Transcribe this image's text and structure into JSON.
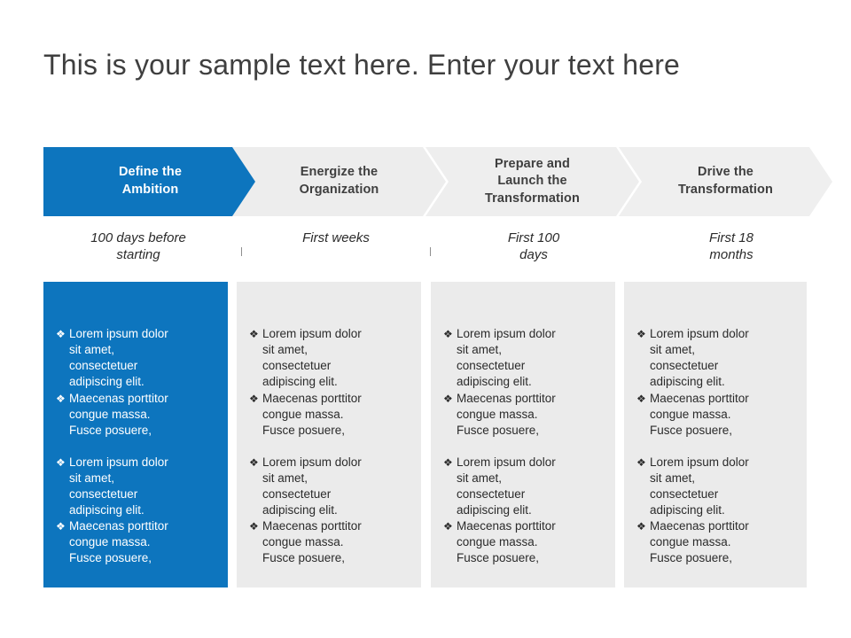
{
  "slide": {
    "title": "This is your sample text here. Enter your text here",
    "accent_color": "#0d75be",
    "idle_color": "#ebebeb",
    "text_color": "#3f3f3f"
  },
  "steps": [
    {
      "chevron_label": "Define the\nAmbition",
      "timeline_label": "100 days before\nstarting",
      "state": "active"
    },
    {
      "chevron_label": "Energize the\nOrganization",
      "timeline_label": "First weeks",
      "state": "idle"
    },
    {
      "chevron_label": "Prepare and\nLaunch the\nTransformation",
      "timeline_label": "First 100\ndays",
      "state": "idle"
    },
    {
      "chevron_label": "Drive the\nTransformation",
      "timeline_label": "First 18\nmonths",
      "state": "idle"
    }
  ],
  "bullet_mark": "❖",
  "bullet_icon_name": "diamond-bullet-icon",
  "bullets": {
    "item_1": "Lorem ipsum dolor\nsit amet,\nconsectetuer\nadipiscing elit.",
    "item_2": "Maecenas porttitor\ncongue massa.\nFusce posuere,"
  }
}
